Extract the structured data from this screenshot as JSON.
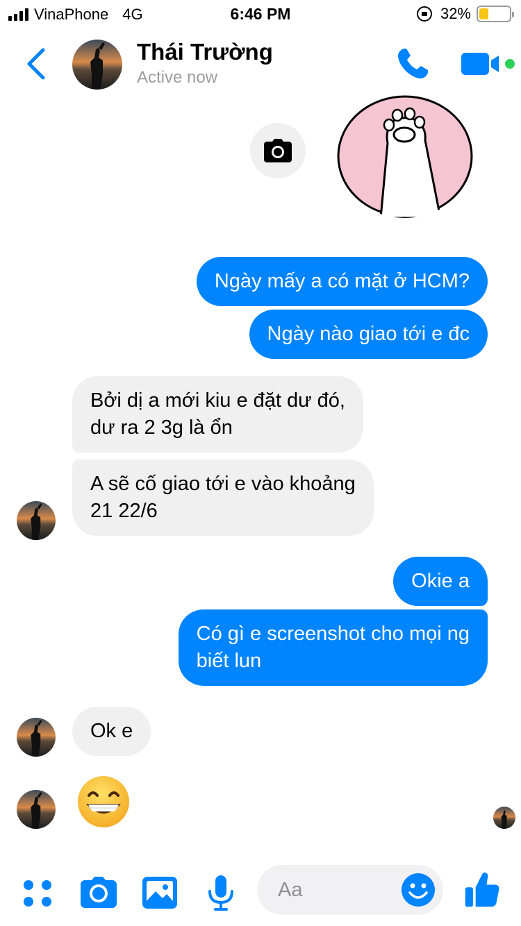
{
  "status_bar": {
    "carrier": "VinaPhone",
    "network": "4G",
    "time": "6:46 PM",
    "battery": "32%",
    "battery_level": 0.32
  },
  "header": {
    "back_icon": "chevron-left-icon",
    "contact_name": "Thái Trường",
    "contact_status": "Active now",
    "call_icon": "phone-icon",
    "video_icon": "video-camera-icon",
    "accent": "#0084ff",
    "online_color": "#2ed158"
  },
  "messages": [
    {
      "from": "me",
      "text": "Ngày mấy a có mặt ở HCM?"
    },
    {
      "from": "me",
      "text": "Ngày nào giao tới e đc"
    },
    {
      "from": "them",
      "line1": "Bởi dị a mới kiu e đặt dư đó,",
      "line2": "dư ra 2 3g là ổn"
    },
    {
      "from": "them",
      "line1": "A sẽ cố giao tới e vào khoảng",
      "line2": "21 22/6"
    },
    {
      "from": "me",
      "text": "Okie a"
    },
    {
      "from": "me",
      "line1": "Có gì e screenshot cho mọi ng",
      "line2": "biết lun"
    },
    {
      "from": "them",
      "text": "Ok e"
    },
    {
      "from": "them",
      "emoji": "grinning-face-icon"
    }
  ],
  "composer": {
    "placeholder": "Aa",
    "icons": [
      "apps-icon",
      "camera-icon",
      "image-icon",
      "microphone-icon",
      "smiley-icon",
      "thumbs-up-icon"
    ]
  }
}
